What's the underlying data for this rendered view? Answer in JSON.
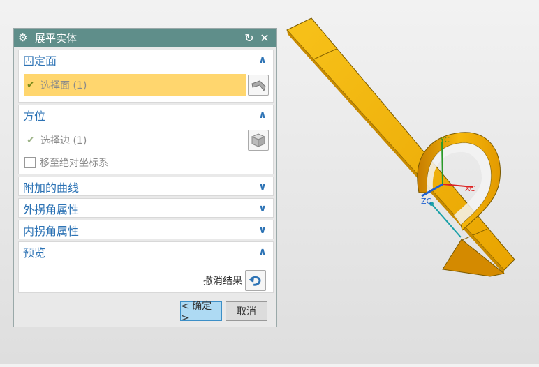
{
  "dialog": {
    "title": "展平实体",
    "reset_icon": "reset-icon",
    "close_icon": "close-icon"
  },
  "sections": {
    "fixed_face": {
      "label": "固定面",
      "select_face": "选择面 (1)"
    },
    "orientation": {
      "label": "方位",
      "select_edge": "选择边 (1)",
      "move_to_absolute": "移至绝对坐标系"
    },
    "additional_curves": {
      "label": "附加的曲线"
    },
    "outer_corner": {
      "label": "外拐角属性"
    },
    "inner_corner": {
      "label": "内拐角属性"
    },
    "preview": {
      "label": "预览",
      "undo_result": "撤消结果"
    }
  },
  "buttons": {
    "ok": "< 确定 >",
    "cancel": "取消"
  },
  "axes": {
    "xc": "XC",
    "yc": "YC",
    "zc": "ZC"
  },
  "colors": {
    "title_bar": "#5f8e8a",
    "accent_blue": "#2d73b5",
    "selection_highlight": "#ffd66e",
    "model_yellow": "#f5b800",
    "ok_button": "#aedaf3"
  }
}
